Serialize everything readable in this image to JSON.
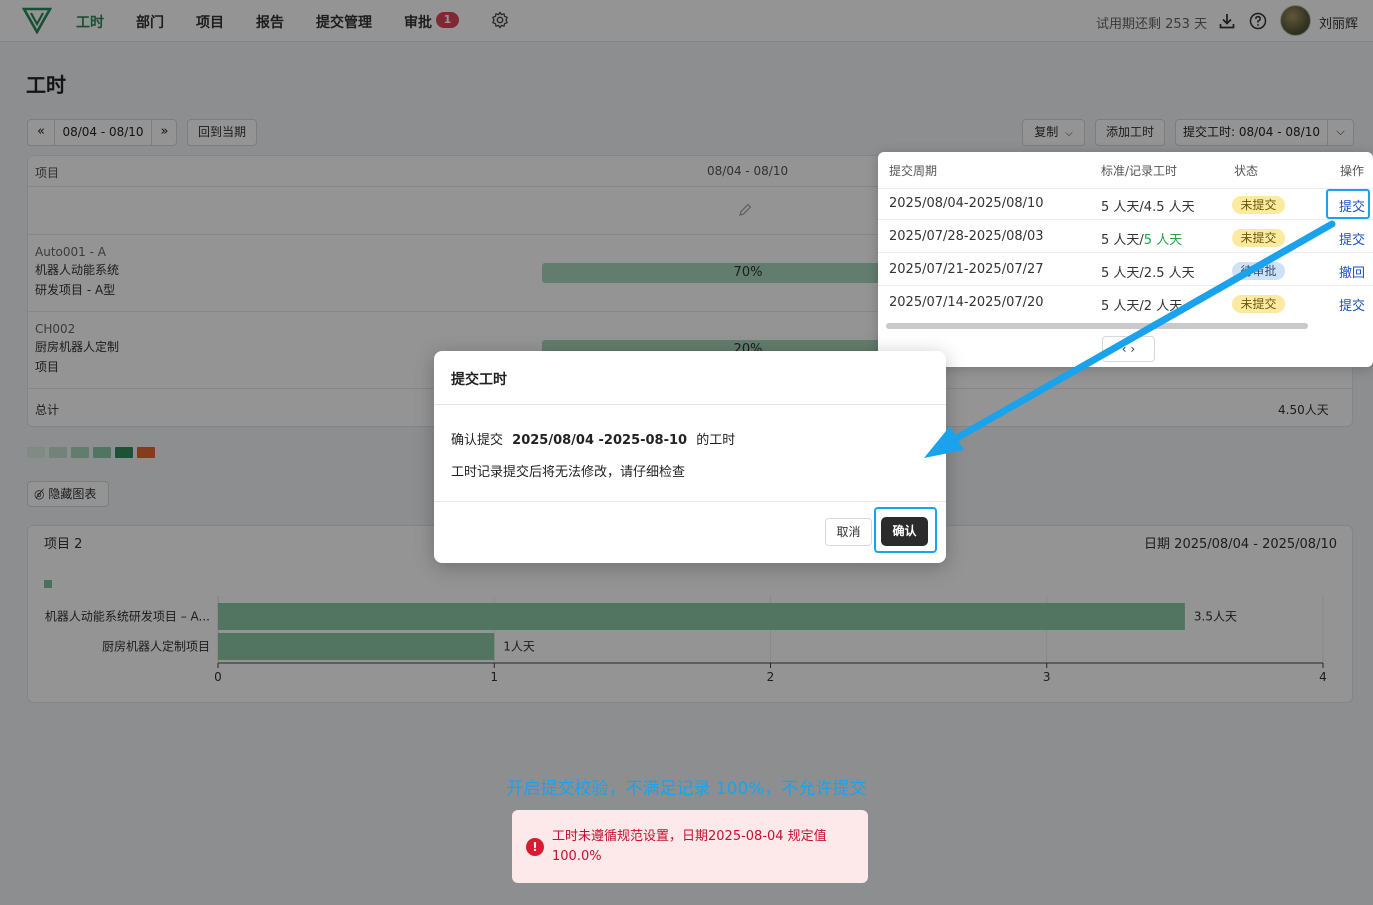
{
  "nav": {
    "items": [
      "工时",
      "部门",
      "项目",
      "报告",
      "提交管理",
      "审批"
    ],
    "approval_badge": "1",
    "trial_text": "试用期还剩 253 天",
    "username": "刘丽辉"
  },
  "page": {
    "title": "工时"
  },
  "toolbar": {
    "prev": "«",
    "week_range": "08/04 - 08/10",
    "next": "»",
    "current_label": "回到当期",
    "copy_label": "复制",
    "add_label": "添加工时",
    "submit_label": "提交工时: 08/04 - 08/10"
  },
  "table": {
    "col_project": "项目",
    "col_week": "08/04 - 08/10",
    "rows": [
      {
        "code": "Auto001 - A",
        "name_line1": "机器人动能系统",
        "name_line2": "研发项目 - A型",
        "percent_label": "70%",
        "percent": 70
      },
      {
        "code": "CH002",
        "name_line1": "厨房机器人定制",
        "name_line2": "项目",
        "percent_label": "20%",
        "percent": 20
      }
    ],
    "total_label": "总计",
    "total_value": "4.50人天"
  },
  "legend_colors": [
    "#dcefe4",
    "#c4e4d2",
    "#a9d8be",
    "#8ccaa7",
    "#2f8f5a",
    "#e8672c"
  ],
  "hide_chart_label": "隐藏图表",
  "chart": {
    "title": "项目 2",
    "date_label": "日期 2025/08/04 - 2025/08/10"
  },
  "chart_data": {
    "type": "bar",
    "orientation": "horizontal",
    "categories": [
      "机器人动能系统研发项目 – A...",
      "厨房机器人定制项目"
    ],
    "values": [
      3.5,
      1
    ],
    "data_labels": [
      "3.5人天",
      "1人天"
    ],
    "xlim": [
      0,
      4
    ],
    "xticks": [
      "0",
      "1",
      "2",
      "3",
      "4"
    ],
    "grid": true,
    "color": "#8ccaa7"
  },
  "popover": {
    "headers": [
      "提交周期",
      "标准/记录工时",
      "状态",
      "操作"
    ],
    "rows": [
      {
        "period": "2025/08/04-2025/08/10",
        "hours_a": "5 人天/",
        "hours_b": "4.5 人天",
        "hours_b_green": false,
        "status": "未提交",
        "status_type": "yellow",
        "action": "提交"
      },
      {
        "period": "2025/07/28-2025/08/03",
        "hours_a": "5 人天/",
        "hours_b": "5 人天",
        "hours_b_green": true,
        "status": "未提交",
        "status_type": "yellow",
        "action": "提交"
      },
      {
        "period": "2025/07/21-2025/07/27",
        "hours_a": "5 人天/",
        "hours_b": "2.5 人天",
        "hours_b_green": false,
        "status": "待审批",
        "status_type": "blue",
        "action": "撤回"
      },
      {
        "period": "2025/07/14-2025/07/20",
        "hours_a": "5 人天/",
        "hours_b": "2 人天",
        "hours_b_green": false,
        "status": "未提交",
        "status_type": "yellow",
        "action": "提交"
      }
    ],
    "pager": "‹  ›"
  },
  "modal": {
    "title": "提交工时",
    "confirm_prefix": "确认提交",
    "confirm_period": "2025/08/04 -2025-08-10",
    "confirm_suffix": "的工时",
    "warning": "工时记录提交后将无法修改，请仔细检查",
    "cancel": "取消",
    "ok": "确认"
  },
  "annotation": "开启提交校验，不满足记录 100%，不允许提交",
  "toast": {
    "icon": "!",
    "message": "工时未遵循规范设置，日期2025-08-04 规定值 100.0%"
  }
}
